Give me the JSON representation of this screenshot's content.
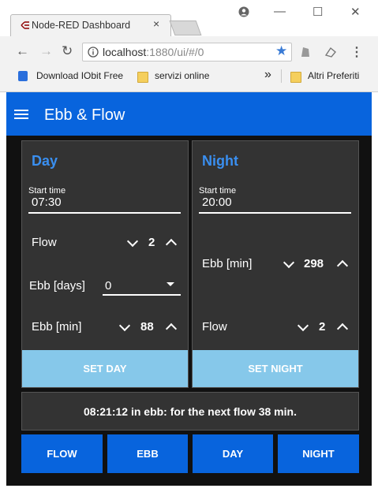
{
  "browser": {
    "tab_title": "Node-RED Dashboard",
    "tab_close": "×",
    "window_controls": {
      "minimize": "—",
      "maximize": "☐",
      "close": "✕"
    },
    "url_host": "localhost",
    "url_path": ":1880/ui/#/0",
    "bookmarks": [
      {
        "label": "Download IObit Free"
      },
      {
        "label": "servizi online"
      },
      {
        "label": "Altri Preferiti"
      }
    ],
    "bookmark_overflow": "»"
  },
  "app": {
    "title": "Ebb & Flow",
    "day": {
      "title": "Day",
      "start_time_label": "Start time",
      "start_time": "07:30",
      "flow_label": "Flow",
      "flow_value": "2",
      "ebb_days_label": "Ebb [days]",
      "ebb_days_value": "0",
      "ebb_min_label": "Ebb [min]",
      "ebb_min_value": "88",
      "button": "SET DAY"
    },
    "night": {
      "title": "Night",
      "start_time_label": "Start time",
      "start_time": "20:00",
      "ebb_min_label": "Ebb [min]",
      "ebb_min_value": "298",
      "flow_label": "Flow",
      "flow_value": "2",
      "button": "SET NIGHT"
    },
    "status": "08:21:12 in ebb: for the next flow 38 min.",
    "buttons": [
      "FLOW",
      "EBB",
      "DAY",
      "NIGHT"
    ],
    "colors": {
      "header": "#0864dd",
      "accent_title": "#3a8ff0",
      "light_button": "#86c8ea",
      "card_bg": "#333333",
      "page_bg": "#111111"
    }
  }
}
